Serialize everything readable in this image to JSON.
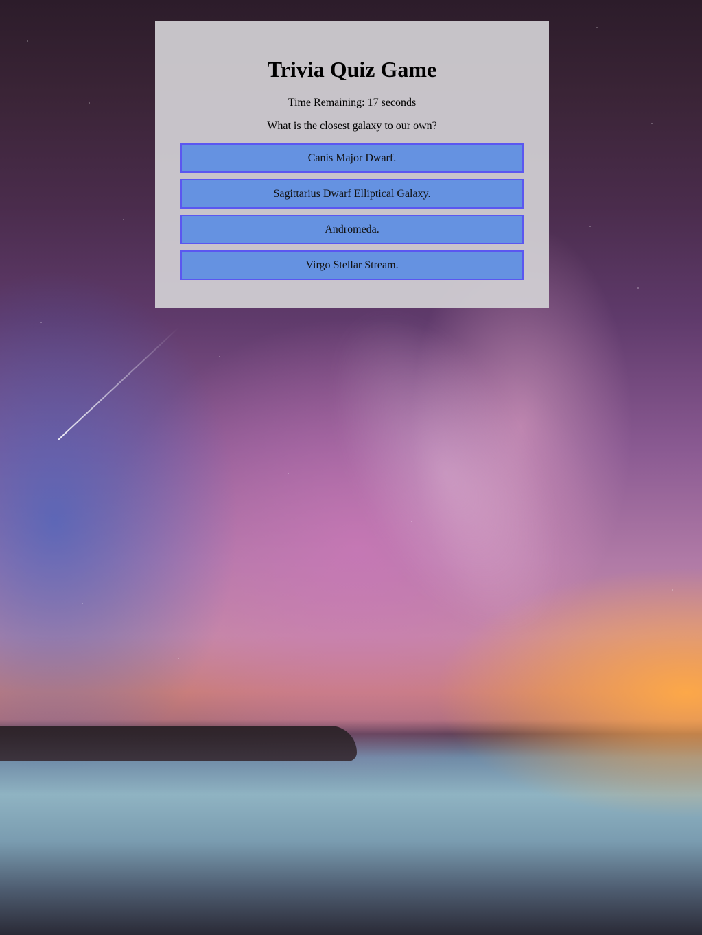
{
  "quiz": {
    "title": "Trivia Quiz Game",
    "timer_text": "Time Remaining: 17 seconds",
    "question": "What is the closest galaxy to our own?",
    "answers": [
      {
        "label": "Canis Major Dwarf."
      },
      {
        "label": "Sagittarius Dwarf Elliptical Galaxy."
      },
      {
        "label": "Andromeda."
      },
      {
        "label": "Virgo Stellar Stream."
      }
    ]
  },
  "colors": {
    "answer_button_bg": "#6592e1",
    "answer_button_border": "#5b57f0",
    "card_bg": "#d2d0d4"
  },
  "background": {
    "image": "night-sky-milky-way-over-sea"
  }
}
